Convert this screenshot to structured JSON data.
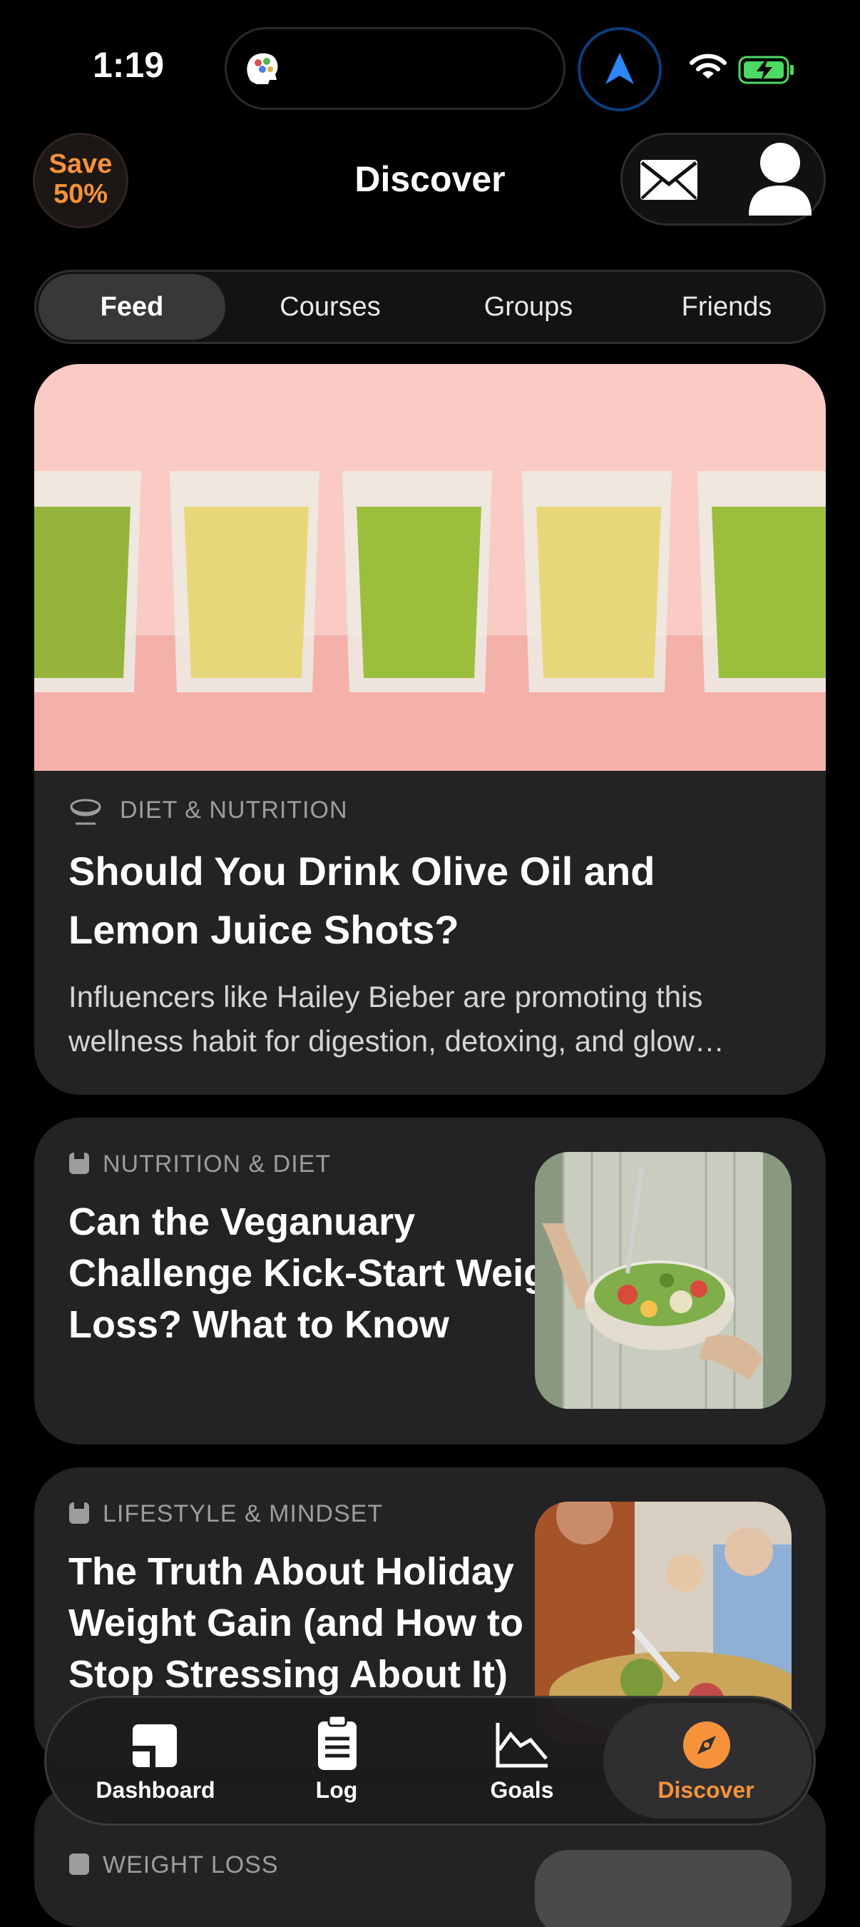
{
  "status_bar": {
    "time": "1:19"
  },
  "header": {
    "promo_line1": "Save",
    "promo_line2": "50%",
    "title": "Discover"
  },
  "tabs": [
    {
      "label": "Feed",
      "active": true
    },
    {
      "label": "Courses",
      "active": false
    },
    {
      "label": "Groups",
      "active": false
    },
    {
      "label": "Friends",
      "active": false
    }
  ],
  "feed": {
    "featured": {
      "category": "DIET & NUTRITION",
      "title_line1": "Should You Drink Olive Oil and",
      "title_line2": "Lemon Juice Shots?",
      "excerpt_line1": "Influencers like Hailey Bieber are promoting this",
      "excerpt_line2": "wellness habit for digestion, detoxing, and glow…"
    },
    "articles": [
      {
        "category": "NUTRITION & DIET",
        "title_line1": "Can the Veganuary",
        "title_line2": "Challenge Kick-Start Weight",
        "title_line3": "Loss? What to Know"
      },
      {
        "category": "LIFESTYLE & MINDSET",
        "title_line1": "The Truth About Holiday",
        "title_line2": "Weight Gain (and How to",
        "title_line3": "Stop Stressing About It)"
      },
      {
        "category": "WEIGHT LOSS"
      }
    ]
  },
  "bottom_nav": [
    {
      "label": "Dashboard",
      "icon": "dashboard-icon"
    },
    {
      "label": "Log",
      "icon": "clipboard-icon"
    },
    {
      "label": "Goals",
      "icon": "chart-icon"
    },
    {
      "label": "Discover",
      "icon": "compass-icon",
      "active": true
    }
  ],
  "colors": {
    "accent": "#f5923a",
    "background": "#000000",
    "card": "#232325",
    "hero_pink": "#f8c7c1"
  }
}
